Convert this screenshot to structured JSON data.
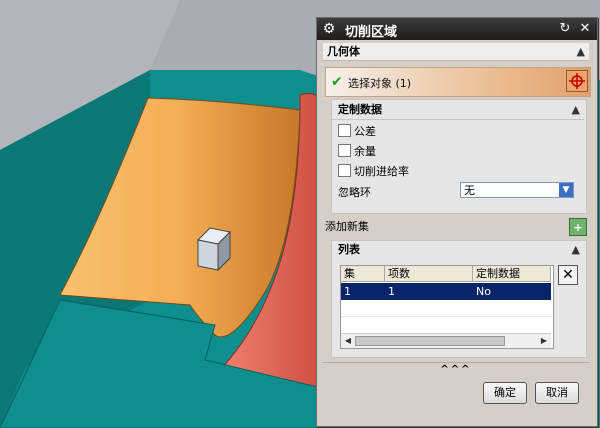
{
  "dialog": {
    "title": "切削区域",
    "title_icon": "gear-icon",
    "reset_icon": "reset-icon",
    "close_icon": "close-icon"
  },
  "geometry_section": {
    "header": "几何体",
    "select_object_label": "选择对象 (1)",
    "target_icon": "crosshair-icon"
  },
  "custom_data": {
    "header": "定制数据",
    "checkboxes": [
      {
        "label": "公差",
        "checked": false
      },
      {
        "label": "余量",
        "checked": false
      },
      {
        "label": "切削进给率",
        "checked": false
      }
    ],
    "ignore_ring_label": "忽略环",
    "ignore_ring_value": "无"
  },
  "add_new_set": {
    "label": "添加新集",
    "icon": "plus-icon"
  },
  "list": {
    "header": "列表",
    "columns": [
      "集",
      "项数",
      "定制数据"
    ],
    "rows": [
      {
        "set": "1",
        "count": "1",
        "custom": "No",
        "selected": true
      }
    ]
  },
  "more_indicator": "^^^",
  "buttons": {
    "ok": "确定",
    "cancel": "取消"
  },
  "colors": {
    "teal_surface": "#0e8e8c",
    "orange_part": "#f2a64e",
    "red_part": "#e3675a",
    "selection_row": "#0a246a"
  }
}
